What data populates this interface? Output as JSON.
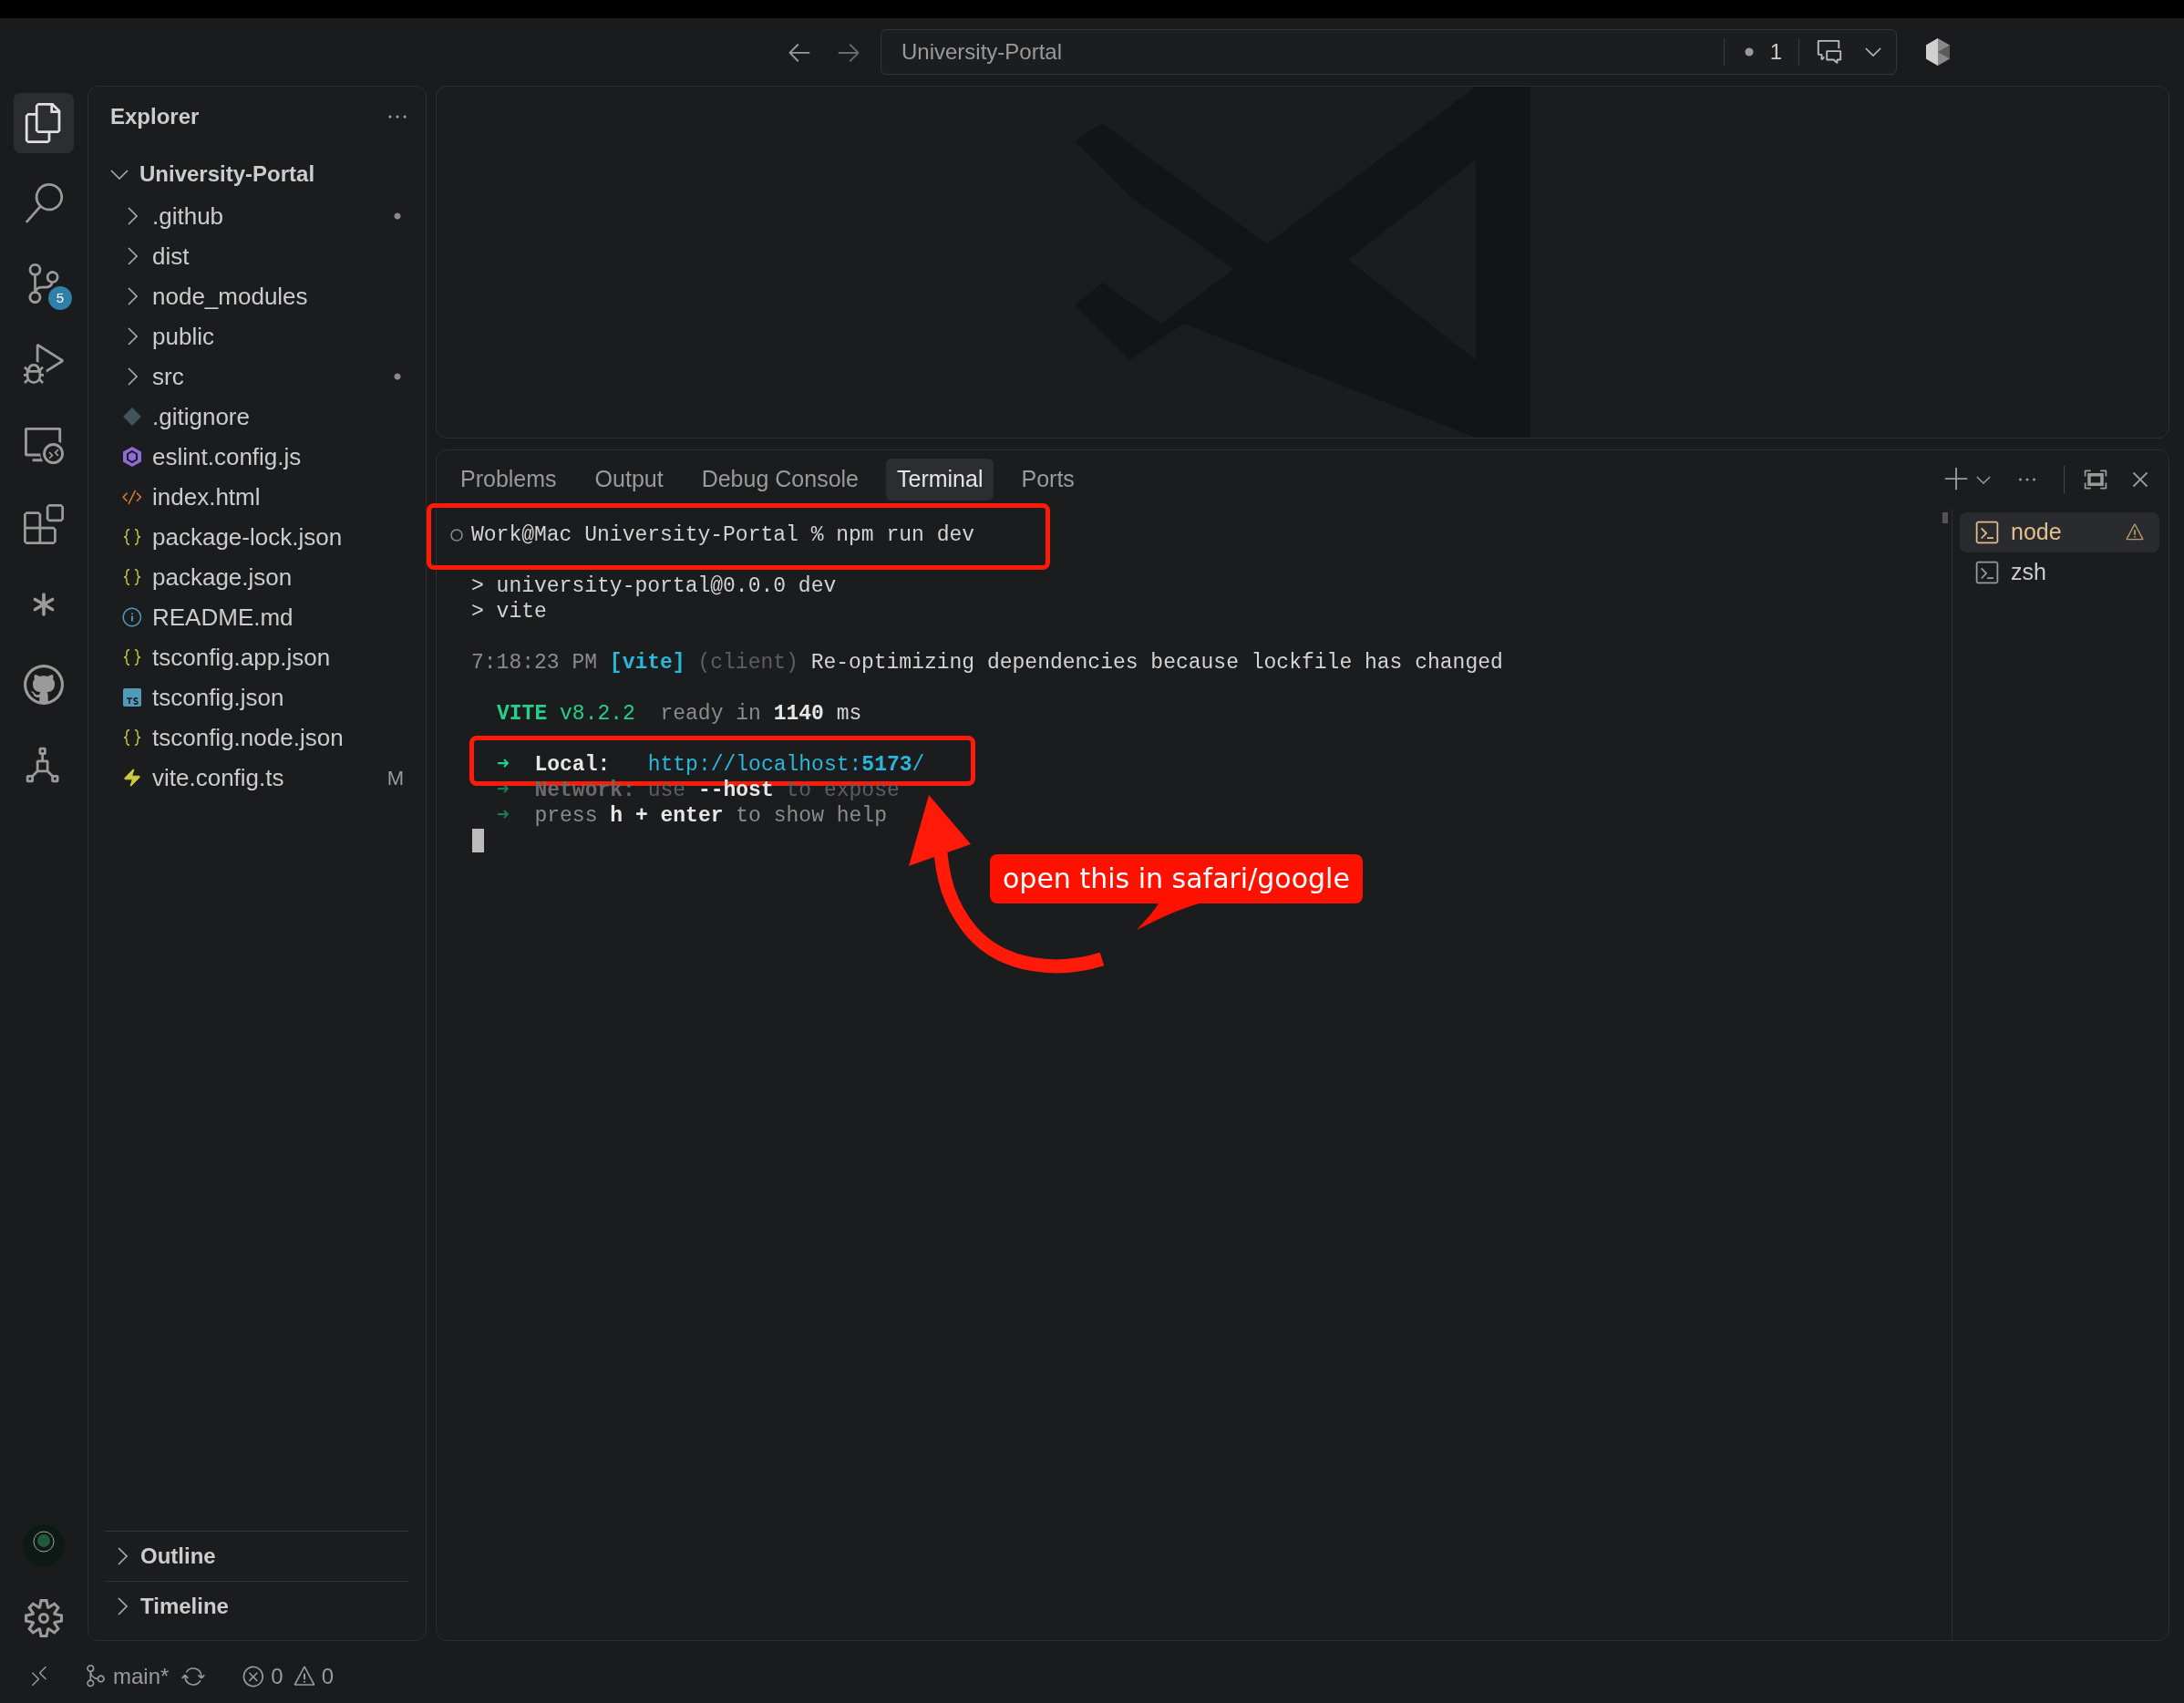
{
  "title_bar": {
    "search": "University-Portal",
    "indicator_count": "1"
  },
  "activity_bar": {
    "items": [
      {
        "selected": true
      },
      {
        "selected": false
      },
      {
        "selected": false,
        "badge": "5"
      },
      {
        "selected": false
      },
      {
        "selected": false
      },
      {
        "selected": false
      },
      {
        "selected": false
      },
      {
        "selected": false
      },
      {
        "selected": false
      }
    ]
  },
  "explorer": {
    "title": "Explorer",
    "root": {
      "label": "University-Portal",
      "expanded": true,
      "children": [
        {
          "kind": "folder",
          "label": ".github",
          "expanded": false,
          "modified_dot": true
        },
        {
          "kind": "folder",
          "label": "dist",
          "expanded": false,
          "modified_dot": false
        },
        {
          "kind": "folder",
          "label": "node_modules",
          "expanded": false,
          "modified_dot": false
        },
        {
          "kind": "folder",
          "label": "public",
          "expanded": false,
          "modified_dot": false
        },
        {
          "kind": "folder",
          "label": "src",
          "expanded": false,
          "modified_dot": true
        },
        {
          "kind": "git",
          "label": ".gitignore"
        },
        {
          "kind": "eslint",
          "label": "eslint.config.js"
        },
        {
          "kind": "html",
          "label": "index.html"
        },
        {
          "kind": "json",
          "label": "package-lock.json"
        },
        {
          "kind": "json",
          "label": "package.json"
        },
        {
          "kind": "info",
          "label": "README.md"
        },
        {
          "kind": "json",
          "label": "tsconfig.app.json"
        },
        {
          "kind": "ts",
          "label": "tsconfig.json"
        },
        {
          "kind": "json",
          "label": "tsconfig.node.json"
        },
        {
          "kind": "vite",
          "label": "vite.config.ts",
          "git_status": "M"
        }
      ]
    },
    "sections": [
      {
        "label": "Outline",
        "expanded": false
      },
      {
        "label": "Timeline",
        "expanded": false
      }
    ]
  },
  "panel": {
    "tabs": [
      {
        "label": "Problems",
        "selected": false
      },
      {
        "label": "Output",
        "selected": false
      },
      {
        "label": "Debug Console",
        "selected": false
      },
      {
        "label": "Terminal",
        "selected": true
      },
      {
        "label": "Ports",
        "selected": false
      }
    ],
    "terminal": {
      "blocks": [
        [
          {
            "kind": "prompt",
            "highlighted": true,
            "segments": [
              {
                "kind": "plain",
                "text": "Work@Mac University-Portal % npm run dev"
              }
            ]
          }
        ],
        [
          {
            "kind": "output",
            "highlighted": false,
            "segments": [
              {
                "kind": "plain",
                "text": "> university-portal@0.0.0 dev"
              }
            ]
          },
          {
            "kind": "output",
            "highlighted": false,
            "segments": [
              {
                "kind": "plain",
                "text": "> vite"
              }
            ]
          }
        ],
        [
          {
            "kind": "output",
            "highlighted": false,
            "segments": [
              {
                "kind": "dim",
                "text": "7:18:23 PM "
              },
              {
                "kind": "cyan-bold",
                "text": "[vite]"
              },
              {
                "kind": "faint",
                "text": " (client) "
              },
              {
                "kind": "plain",
                "text": "Re-optimizing dependencies because lockfile has changed"
              }
            ]
          }
        ],
        [
          {
            "kind": "indented",
            "highlighted": false,
            "segments": [
              {
                "kind": "green-bold",
                "text": "VITE"
              },
              {
                "kind": "green",
                "text": " v8.2.2"
              },
              {
                "kind": "dim",
                "text": "  ready in "
              },
              {
                "kind": "bold",
                "text": "1140"
              },
              {
                "kind": "plain",
                "text": " ms"
              }
            ]
          }
        ],
        [
          {
            "kind": "indented",
            "highlighted": true,
            "segments": [
              {
                "kind": "green",
                "text": "➜  "
              },
              {
                "kind": "bold",
                "text": "Local:   "
              },
              {
                "kind": "cyan",
                "text": "http://localhost:"
              },
              {
                "kind": "cyan-bold",
                "text": "5173"
              },
              {
                "kind": "cyan",
                "text": "/"
              }
            ]
          },
          {
            "kind": "indented",
            "highlighted": false,
            "segments": [
              {
                "kind": "green-dim",
                "text": "➜  "
              },
              {
                "kind": "bold-dim",
                "text": "Network:"
              },
              {
                "kind": "faint",
                "text": " use "
              },
              {
                "kind": "bold",
                "text": "--host"
              },
              {
                "kind": "faint",
                "text": " to expose"
              }
            ]
          },
          {
            "kind": "indented",
            "highlighted": false,
            "segments": [
              {
                "kind": "green-dim",
                "text": "➜  "
              },
              {
                "kind": "dim",
                "text": "press "
              },
              {
                "kind": "bold",
                "text": "h + enter"
              },
              {
                "kind": "dim",
                "text": " to show help"
              }
            ]
          }
        ]
      ],
      "cursor": true,
      "annotation": {
        "text": "open this in safari/google"
      }
    },
    "sessions": [
      {
        "label": "node",
        "selected": true,
        "warning": true
      },
      {
        "label": "zsh",
        "selected": false,
        "warning": false
      }
    ]
  },
  "status_bar": {
    "branch": "main*",
    "errors": "0",
    "warnings": "0"
  }
}
